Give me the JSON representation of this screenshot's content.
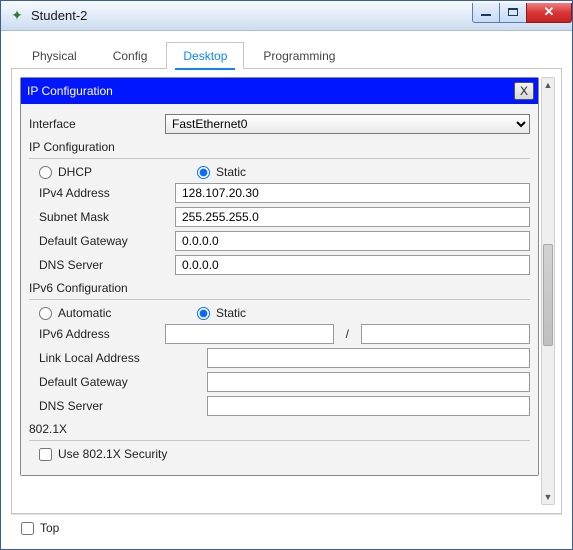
{
  "window": {
    "title": "Student-2"
  },
  "tabs": {
    "physical": "Physical",
    "config": "Config",
    "desktop": "Desktop",
    "programming": "Programming",
    "active": "desktop"
  },
  "dialog": {
    "title": "IP Configuration",
    "close": "X",
    "interface_label": "Interface",
    "interface_value": "FastEthernet0",
    "group_ip": "IP Configuration",
    "dhcp_label": "DHCP",
    "static_label": "Static",
    "ipv4": {
      "address_label": "IPv4 Address",
      "address_value": "128.107.20.30",
      "mask_label": "Subnet Mask",
      "mask_value": "255.255.255.0",
      "gw_label": "Default Gateway",
      "gw_value": "0.0.0.0",
      "dns_label": "DNS Server",
      "dns_value": "0.0.0.0"
    },
    "group_ipv6": "IPv6 Configuration",
    "auto_label": "Automatic",
    "ipv6": {
      "address_label": "IPv6 Address",
      "address_value": "",
      "prefix_sep": "/",
      "prefix_value": "",
      "lla_label": "Link Local Address",
      "lla_value": "",
      "gw_label": "Default Gateway",
      "gw_value": "",
      "dns_label": "DNS Server",
      "dns_value": ""
    },
    "group_8021x": "802.1X",
    "use_8021x_label": "Use 802.1X Security"
  },
  "footer": {
    "top_label": "Top"
  }
}
